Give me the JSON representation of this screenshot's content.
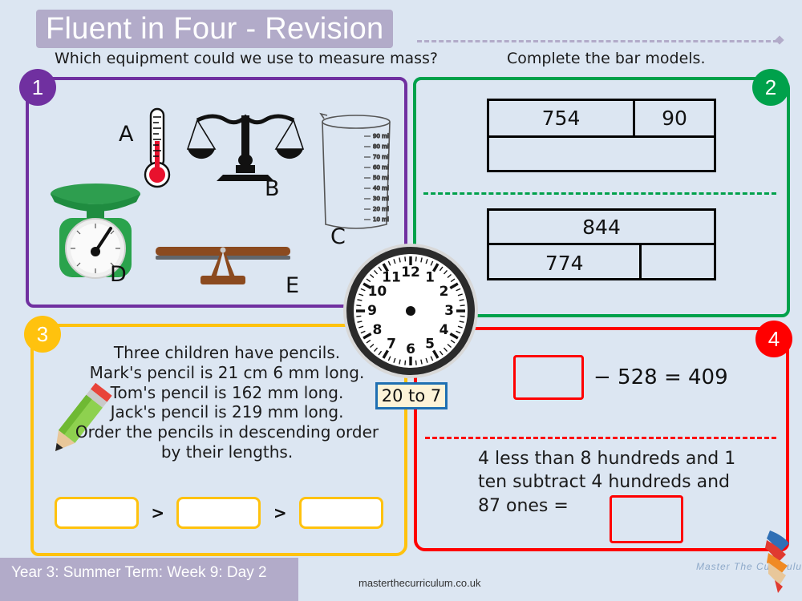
{
  "header": {
    "title": "Fluent in Four - Revision"
  },
  "sections": {
    "q1": {
      "badge": "1",
      "prompt": "Which equipment could we use to measure mass?",
      "accent": "#7030a0",
      "equipment": [
        {
          "label": "A",
          "icon": "thermometer-icon",
          "name": "thermometer"
        },
        {
          "label": "B",
          "icon": "balance-scales-icon",
          "name": "balance scales"
        },
        {
          "label": "C",
          "icon": "measuring-beaker-icon",
          "name": "measuring beaker"
        },
        {
          "label": "D",
          "icon": "kitchen-scale-icon",
          "name": "kitchen scale"
        },
        {
          "label": "E",
          "icon": "seesaw-balance-icon",
          "name": "seesaw balance"
        }
      ],
      "beaker_markings": [
        "90 ml",
        "80 ml",
        "70 ml",
        "60 ml",
        "50 ml",
        "40 ml",
        "30 ml",
        "20 ml",
        "10 ml"
      ]
    },
    "q2": {
      "badge": "2",
      "prompt": "Complete the bar models.",
      "accent": "#00a14b",
      "bar_models": [
        {
          "top": [
            "754",
            "90"
          ],
          "bottom": [
            ""
          ]
        },
        {
          "top": [
            "844"
          ],
          "bottom": [
            "774",
            ""
          ]
        }
      ]
    },
    "q3": {
      "badge": "3",
      "accent": "#ffc20e",
      "text": "Three children have pencils.\nMark's pencil is 21 cm 6 mm long.\nTom's pencil is 162 mm long.\nJack's pencil is 219 mm long.\nOrder the pencils in descending order\nby their lengths.",
      "answers": [
        "",
        "",
        ""
      ],
      "separator": ">"
    },
    "q4": {
      "badge": "4",
      "accent": "#ff0000",
      "equation_box": "",
      "equation_text": "− 528 = 409",
      "word_problem": "4 less than 8 hundreds and 1 ten subtract 4 hundreds and 87 ones =",
      "word_problem_answer": ""
    }
  },
  "clock": {
    "hour_numbers": [
      "12",
      "1",
      "2",
      "3",
      "4",
      "5",
      "6",
      "7",
      "8",
      "9",
      "10",
      "11"
    ],
    "time_label": "20 to 7"
  },
  "footer": {
    "lesson": "Year 3: Summer Term: Week 9: Day 2",
    "url": "masterthecurriculum.co.uk",
    "brand": "Master The Curriculum"
  }
}
